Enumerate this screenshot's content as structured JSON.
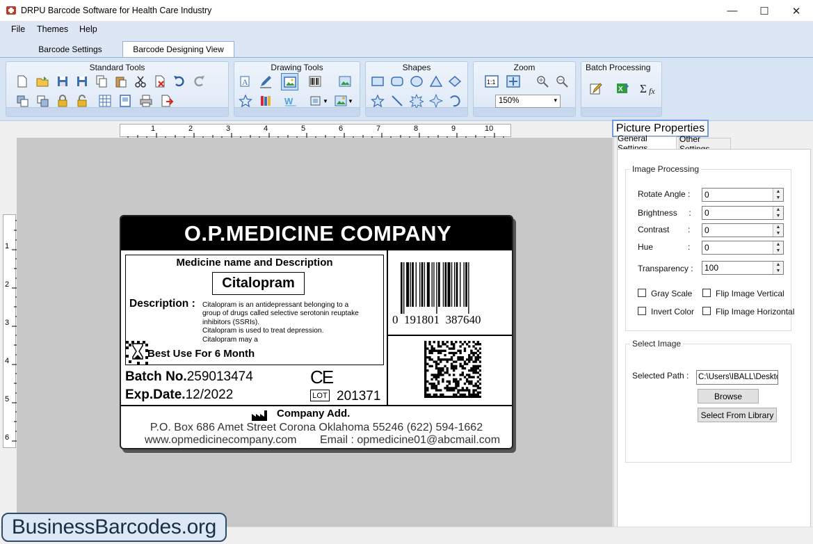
{
  "window": {
    "title": "DRPU Barcode Software for Health Care Industry",
    "minimize": "—",
    "maximize": "☐",
    "close": "✕"
  },
  "menu": {
    "file": "File",
    "themes": "Themes",
    "help": "Help"
  },
  "tabs": {
    "settings": "Barcode Settings",
    "design": "Barcode Designing View"
  },
  "ribbon": {
    "standard": "Standard Tools",
    "drawing": "Drawing Tools",
    "shapes": "Shapes",
    "zoom": "Zoom",
    "zoom_value": "150%",
    "batch": "Batch Processing"
  },
  "rulers": {
    "top": [
      "1",
      "2",
      "3",
      "4",
      "5",
      "6",
      "7",
      "8",
      "9",
      "10"
    ],
    "left": [
      "1",
      "2",
      "3",
      "4",
      "5",
      "6"
    ]
  },
  "label": {
    "company": "O.P.MEDICINE COMPANY",
    "desc_heading": "Medicine name and Description",
    "medicine_name": "Citalopram",
    "desc_label": "Description :",
    "desc_text_1": "Citalopram is an antidepressant belonging to a",
    "desc_text_2": "group of drugs called selective serotonin reuptake",
    "desc_text_3": "inhibitors (SSRIs).",
    "desc_text_4": "Citalopram is used to treat depression.",
    "desc_text_5": "Citalopram may a",
    "best_use": "Best Use For 6 Month",
    "batch_label": "Batch No.",
    "batch_no": "259013474",
    "exp_label": "Exp.Date.",
    "exp_date": "12/2022",
    "ce": "CE",
    "lot_label": "LOT",
    "lot_no": "201371",
    "barcode_digits": "0  191801  387640",
    "company_add": "Company Add.",
    "address": "P.O. Box 686 Amet Street Corona Oklahoma 55246 (622) 594-1662",
    "website": "www.opmedicinecompany.com",
    "email": "Email : opmedicine01@abcmail.com"
  },
  "panel": {
    "title": "Picture Properties",
    "tab_general": "General Settings",
    "tab_other": "Other Settings",
    "image_processing": "Image Processing",
    "rotate_label": "Rotate Angle :",
    "rotate": "0",
    "brightness_label": "Brightness     :",
    "brightness": "0",
    "contrast_label": "Contrast        :",
    "contrast": "0",
    "hue_label": "Hue               :",
    "hue": "0",
    "transparency_label": "Transparency :",
    "transparency": "100",
    "gray_scale": "Gray Scale",
    "flip_vertical": "Flip Image Vertical",
    "invert_color": "Invert Color",
    "flip_horizontal": "Flip Image Horizontal",
    "select_image": "Select Image",
    "selected_path_label": "Selected Path :",
    "selected_path": "C:\\Users\\IBALL\\Deskto",
    "browse": "Browse",
    "select_library": "Select From Library"
  },
  "watermark": "BusinessBarcodes.org",
  "colors": {
    "ribbon": "#d7e4f4",
    "accent": "#6c9be0",
    "label_header": "#000000"
  }
}
